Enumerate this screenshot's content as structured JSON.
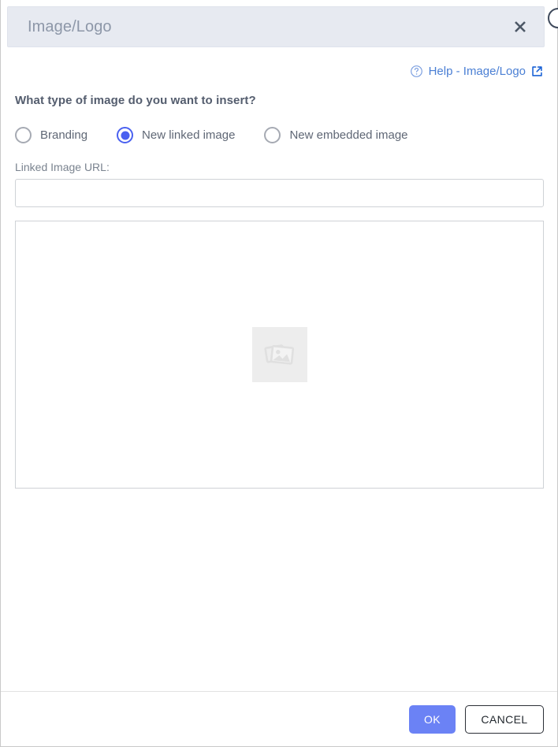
{
  "dialog": {
    "title": "Image/Logo",
    "close_icon": "close-x-icon",
    "edge_badge_icon": "circle-badge-icon"
  },
  "help": {
    "icon": "question-circle-icon",
    "label": "Help - Image/Logo",
    "external_icon": "external-link-icon",
    "color": "#4a7fd4"
  },
  "form": {
    "question": "What type of image do you want to insert?",
    "options": [
      {
        "label": "Branding",
        "selected": false
      },
      {
        "label": "New linked image",
        "selected": true
      },
      {
        "label": "New embedded image",
        "selected": false
      }
    ],
    "url_label": "Linked Image URL:",
    "url_value": "",
    "url_placeholder": ""
  },
  "preview": {
    "placeholder_icon": "broken-image-icon",
    "placeholder_bg": "#ededed"
  },
  "footer": {
    "ok_label": "OK",
    "cancel_label": "CANCEL",
    "ok_color": "#6b82f5"
  },
  "colors": {
    "titlebar_bg": "#e7eaf1",
    "accent_blue": "#4a61f0",
    "link_blue": "#4a7fd4",
    "text_dark": "#545d6e",
    "border": "#cfd2d6"
  }
}
